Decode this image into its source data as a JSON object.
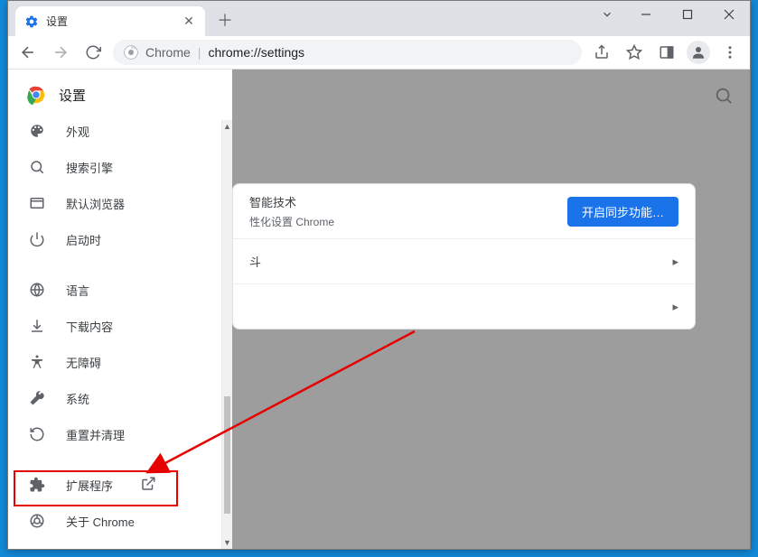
{
  "tab": {
    "title": "设置"
  },
  "omnibox": {
    "prefix": "Chrome",
    "rest": "chrome://settings"
  },
  "sidebar": {
    "header": "设置",
    "items": [
      {
        "icon": "palette",
        "label": "外观"
      },
      {
        "icon": "search",
        "label": "搜索引擎"
      },
      {
        "icon": "browser",
        "label": "默认浏览器"
      },
      {
        "icon": "power",
        "label": "启动时"
      },
      {
        "icon": "globe",
        "label": "语言"
      },
      {
        "icon": "download",
        "label": "下载内容"
      },
      {
        "icon": "accessibility",
        "label": "无障碍"
      },
      {
        "icon": "wrench",
        "label": "系统"
      },
      {
        "icon": "restore",
        "label": "重置并清理"
      },
      {
        "icon": "extension",
        "label": "扩展程序"
      },
      {
        "icon": "chrome",
        "label": "关于 Chrome"
      }
    ]
  },
  "main": {
    "row1_line1": "智能技术",
    "row1_line2": "性化设置 Chrome",
    "sync_button": "开启同步功能…",
    "row2_text": "斗"
  }
}
